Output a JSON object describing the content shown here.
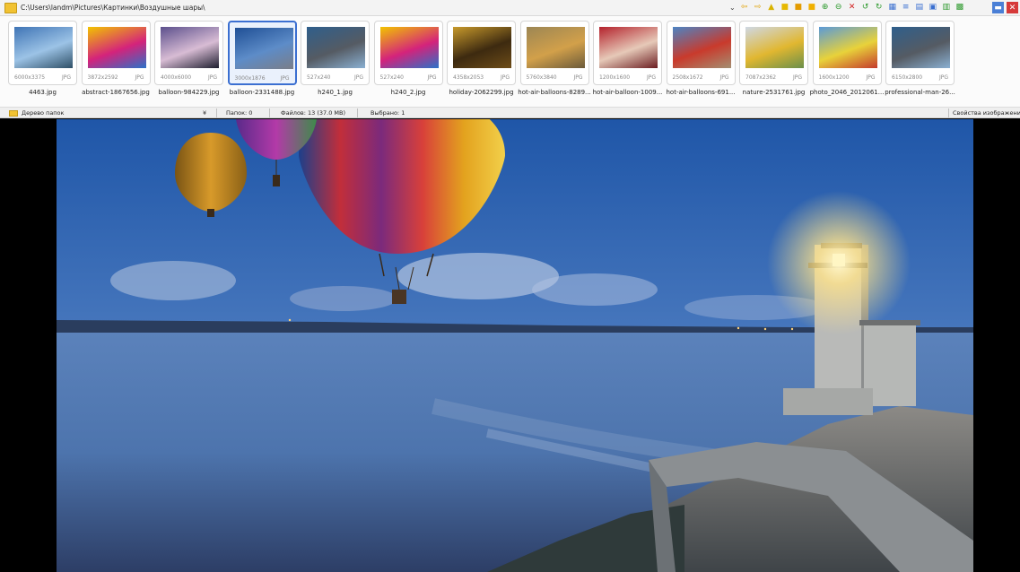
{
  "pathbar": {
    "path": "C:\\Users\\landm\\Pictures\\Картинки\\Воздушные шары\\",
    "dropdown_glyph": "⌄",
    "toolbar_icons": [
      {
        "name": "back-arrow-icon",
        "glyph": "⇦",
        "color": "#e0a000"
      },
      {
        "name": "forward-arrow-icon",
        "glyph": "⇨",
        "color": "#e0a000"
      },
      {
        "name": "folder-up-icon",
        "glyph": "▲",
        "color": "#d9b300"
      },
      {
        "name": "folder-icon",
        "glyph": "■",
        "color": "#e6b800"
      },
      {
        "name": "image-icon",
        "glyph": "■",
        "color": "#e39b00"
      },
      {
        "name": "open-icon",
        "glyph": "■",
        "color": "#f0b000"
      },
      {
        "name": "zoom-in-icon",
        "glyph": "⊕",
        "color": "#2e9a2e"
      },
      {
        "name": "zoom-out-icon",
        "glyph": "⊖",
        "color": "#2e9a2e"
      },
      {
        "name": "delete-icon",
        "glyph": "✕",
        "color": "#d21f1f"
      },
      {
        "name": "rotate-left-icon",
        "glyph": "↺",
        "color": "#2e9a2e"
      },
      {
        "name": "rotate-right-icon",
        "glyph": "↻",
        "color": "#2e9a2e"
      },
      {
        "name": "edit-icon",
        "glyph": "▦",
        "color": "#3a6fd0"
      },
      {
        "name": "adjust-icon",
        "glyph": "≡",
        "color": "#3a6fd0"
      },
      {
        "name": "slideshow-icon",
        "glyph": "▤",
        "color": "#3a6fd0"
      },
      {
        "name": "print-icon",
        "glyph": "▣",
        "color": "#3a6fd0"
      },
      {
        "name": "save-icon",
        "glyph": "▥",
        "color": "#2e9a2e"
      },
      {
        "name": "fullscreen-icon",
        "glyph": "▩",
        "color": "#2e9a2e"
      }
    ],
    "window_buttons": [
      {
        "name": "minimize-button",
        "glyph": "▬",
        "color": "#4a7fd6"
      },
      {
        "name": "close-button",
        "glyph": "✕",
        "color": "#d63a3a"
      }
    ]
  },
  "thumbnails": [
    {
      "name": "4463.jpg",
      "dims": "6000x3375",
      "format": "JPG",
      "selected": false,
      "palette": [
        "#3f74b5",
        "#9cc3e6",
        "#2e4f66"
      ]
    },
    {
      "name": "abstract-1867656.jpg",
      "dims": "3872x2592",
      "format": "JPG",
      "selected": false,
      "palette": [
        "#f2c400",
        "#d4237b",
        "#2b71c8"
      ]
    },
    {
      "name": "balloon-984229.jpg",
      "dims": "4000x6000",
      "format": "JPG",
      "selected": false,
      "palette": [
        "#5b4f8c",
        "#d8bcd4",
        "#1d1d2e"
      ]
    },
    {
      "name": "balloon-2331488.jpg",
      "dims": "3000x1876",
      "format": "JPG",
      "selected": true,
      "palette": [
        "#1f4f95",
        "#5d8cc8",
        "#7a7e88"
      ]
    },
    {
      "name": "h240_1.jpg",
      "dims": "527x240",
      "format": "JPG",
      "selected": false,
      "palette": [
        "#2f5f8c",
        "#555b63",
        "#8ab0d2"
      ]
    },
    {
      "name": "h240_2.jpg",
      "dims": "527x240",
      "format": "JPG",
      "selected": false,
      "palette": [
        "#f2c400",
        "#d4237b",
        "#2b71c8"
      ]
    },
    {
      "name": "holiday-2062299.jpg",
      "dims": "4358x2053",
      "format": "JPG",
      "selected": false,
      "palette": [
        "#c89a2c",
        "#3d2a10",
        "#6d4c18"
      ]
    },
    {
      "name": "hot-air-balloons-8289...",
      "dims": "5760x3840",
      "format": "JPG",
      "selected": false,
      "palette": [
        "#9c8654",
        "#d2a04a",
        "#6b5a3a"
      ]
    },
    {
      "name": "hot-air-balloon-1009...",
      "dims": "1200x1600",
      "format": "JPG",
      "selected": false,
      "palette": [
        "#b4222c",
        "#e6c9b8",
        "#6b1c20"
      ]
    },
    {
      "name": "hot-air-balloons-691...",
      "dims": "2508x1672",
      "format": "JPG",
      "selected": false,
      "palette": [
        "#4c84c4",
        "#c93a2c",
        "#a48f72"
      ]
    },
    {
      "name": "nature-2531761.jpg",
      "dims": "7087x2362",
      "format": "JPG",
      "selected": false,
      "palette": [
        "#cfd8e4",
        "#e1b730",
        "#6a8f4a"
      ]
    },
    {
      "name": "photo_2046_2012061...",
      "dims": "1600x1200",
      "format": "JPG",
      "selected": false,
      "palette": [
        "#5a9ad8",
        "#e8d23a",
        "#c43a2c"
      ]
    },
    {
      "name": "professional-man-26...",
      "dims": "6150x2800",
      "format": "JPG",
      "selected": false,
      "palette": [
        "#2f5f8c",
        "#555b63",
        "#8ab0d2"
      ]
    }
  ],
  "statusbar": {
    "folder_tree": "Дерево папок",
    "collapse_glyph": "¥",
    "folders": "Папок: 0",
    "files": "Файлов: 13 (37.0 MB)",
    "selected": "Выбрано: 1",
    "properties": "Свойства изображения",
    "properties_glyph": "¥"
  },
  "colors": {
    "selection_border": "#3b6fd1",
    "sky_top": "#1f56a8",
    "sky_bottom": "#9fb6d8",
    "sea": "#4d74ad"
  }
}
